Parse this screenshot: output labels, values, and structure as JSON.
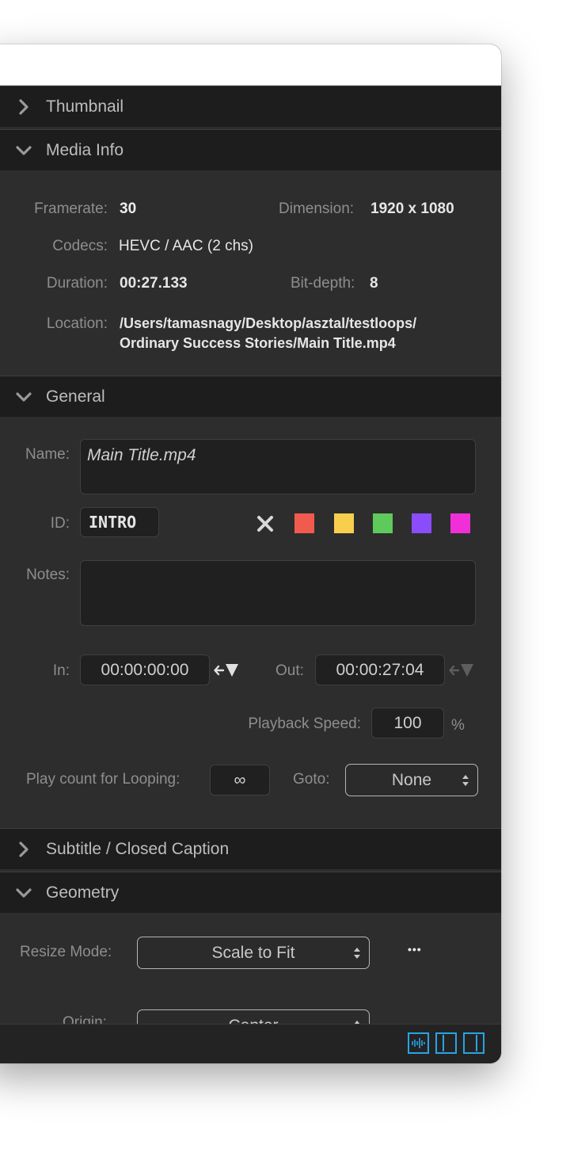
{
  "sections": {
    "thumbnail": "Thumbnail",
    "media_info": "Media Info",
    "general": "General",
    "subtitle": "Subtitle / Closed Caption",
    "geometry": "Geometry"
  },
  "media_info": {
    "framerate_label": "Framerate:",
    "framerate_value": "30",
    "dimension_label": "Dimension:",
    "dimension_value": "1920 x 1080",
    "codecs_label": "Codecs:",
    "codecs_value": "HEVC / AAC (2 chs)",
    "duration_label": "Duration:",
    "duration_value": "00:27.133",
    "bitdepth_label": "Bit-depth:",
    "bitdepth_value": "8",
    "location_label": "Location:",
    "location_line1": "/Users/tamasnagy/Desktop/asztal/testloops/",
    "location_line2": "Ordinary Success Stories/Main Title.mp4"
  },
  "general": {
    "name_label": "Name:",
    "name_value": "Main Title.mp4",
    "id_label": "ID:",
    "id_value": "INTRO",
    "notes_label": "Notes:",
    "notes_value": "",
    "in_label": "In:",
    "in_value": "00:00:00:00",
    "out_label": "Out:",
    "out_value": "00:00:27:04",
    "playback_label": "Playback  Speed:",
    "playback_value": "100",
    "playback_unit": "%",
    "loop_label": "Play count for Looping:",
    "loop_value": "∞",
    "goto_label": "Goto:",
    "goto_value": "None"
  },
  "colors": {
    "tags": [
      "#f15b4e",
      "#f8cf4c",
      "#5dca5b",
      "#8b4dfb",
      "#f12fd9"
    ],
    "accent": "#29a3e6"
  },
  "geometry": {
    "resize_label": "Resize Mode:",
    "resize_value": "Scale to Fit",
    "more_label": "•••",
    "origin_label": "Origin:",
    "origin_value": "Center"
  }
}
